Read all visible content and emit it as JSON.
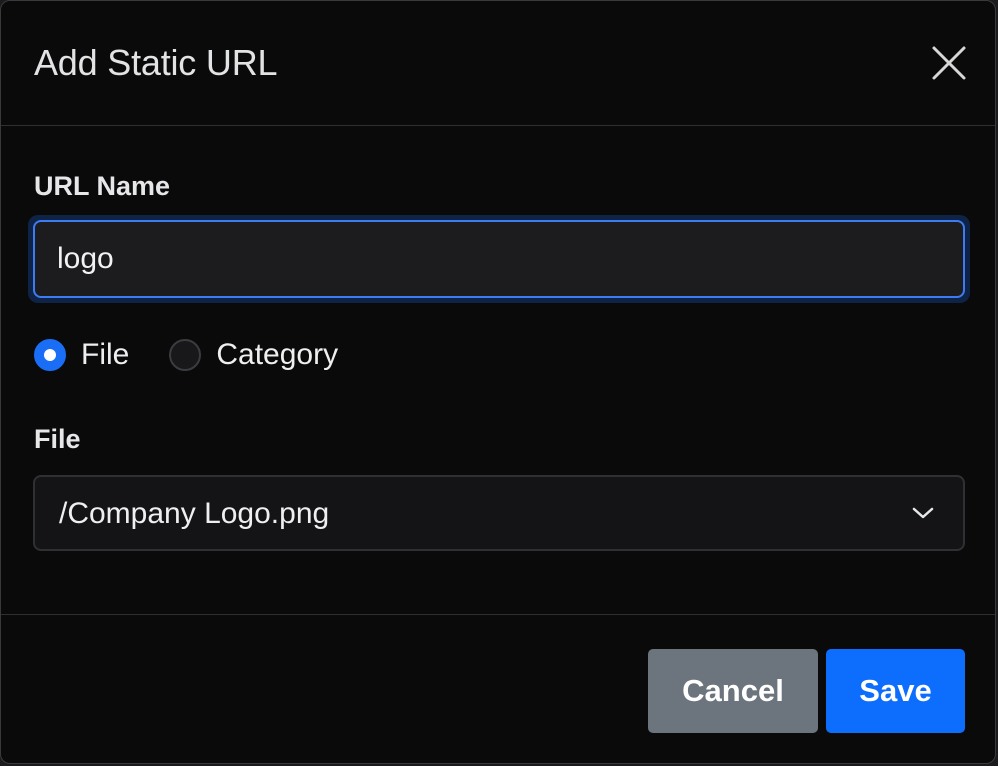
{
  "dialog": {
    "title": "Add Static URL"
  },
  "form": {
    "url_name_label": "URL Name",
    "url_name_value": "logo",
    "source_type": {
      "options": [
        {
          "label": "File",
          "checked": true
        },
        {
          "label": "Category",
          "checked": false
        }
      ]
    },
    "file_label": "File",
    "file_selected": "/Company Logo.png"
  },
  "footer": {
    "cancel_label": "Cancel",
    "save_label": "Save"
  },
  "icons": {
    "close": "close-icon",
    "chevron": "chevron-down-icon"
  },
  "colors": {
    "accent": "#0d6efd",
    "secondary": "#6c757d",
    "background": "#0a0a0b"
  }
}
